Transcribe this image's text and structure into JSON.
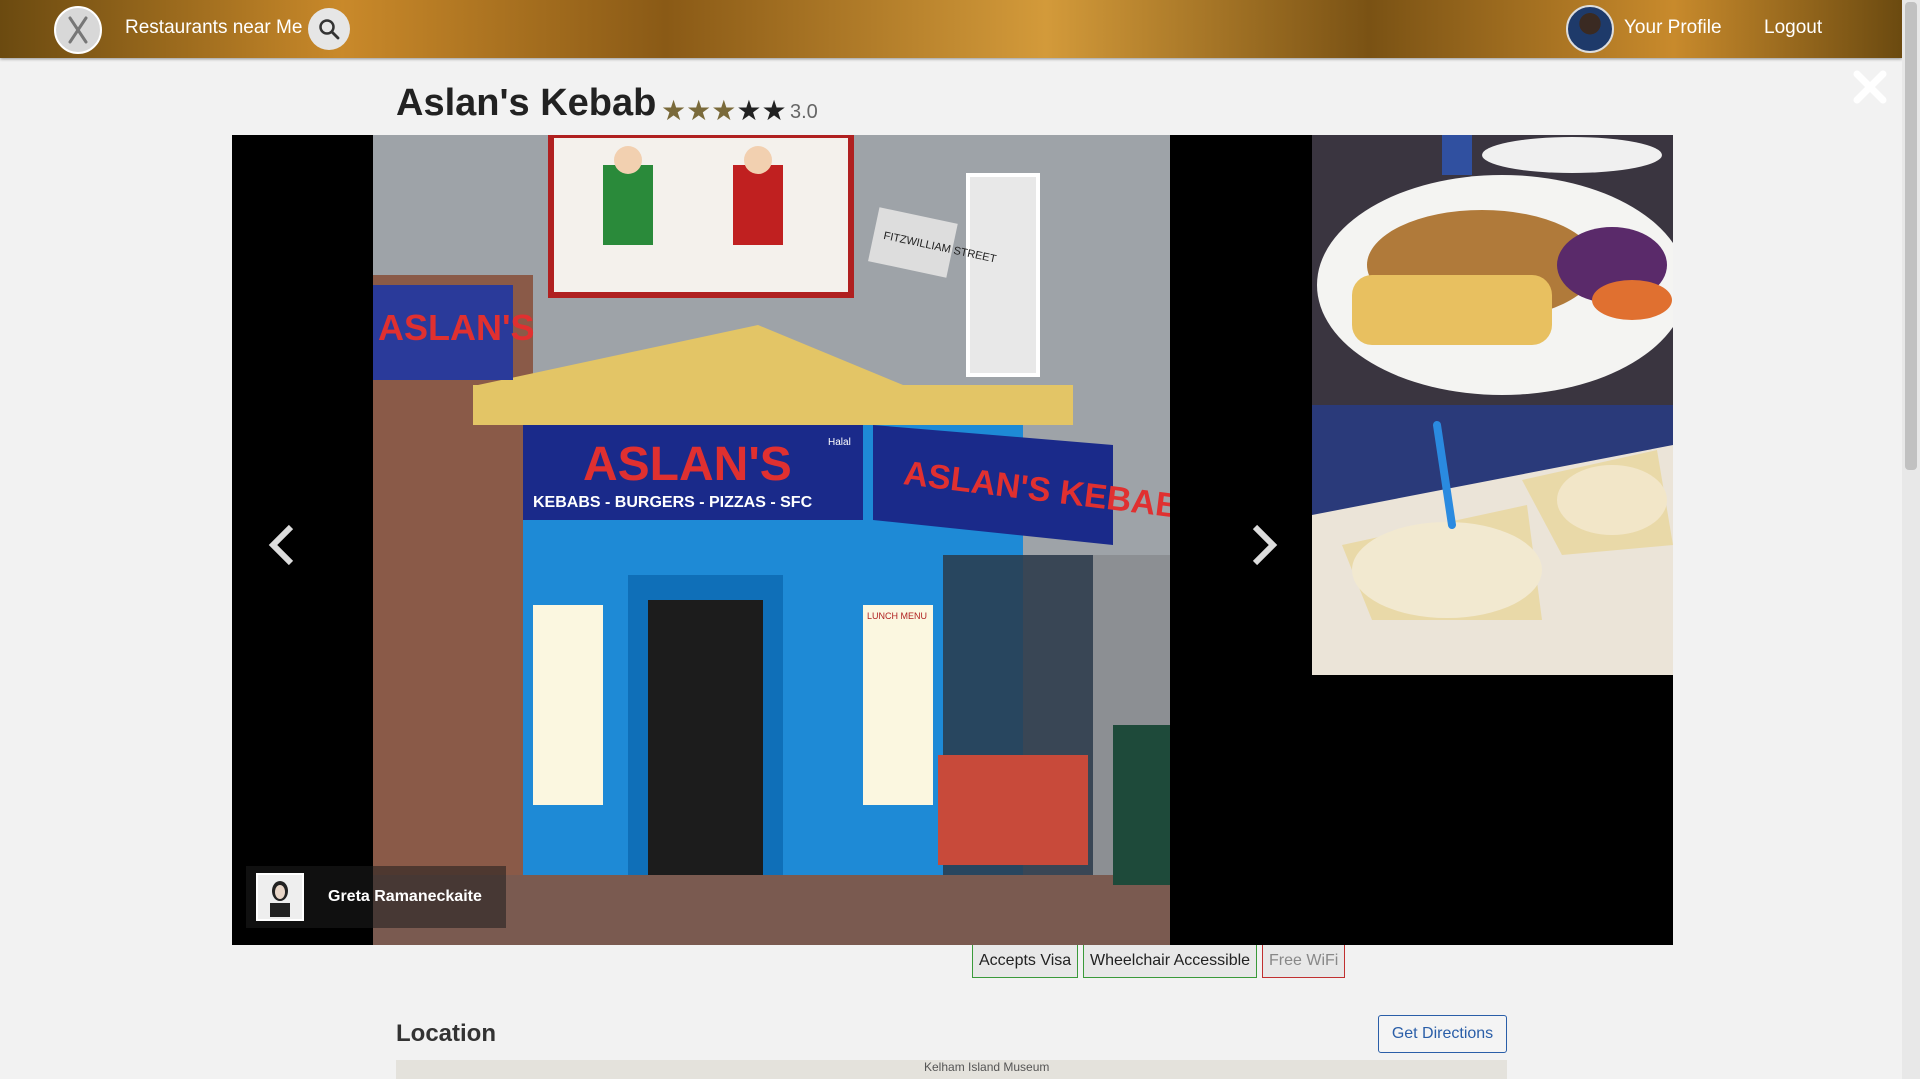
{
  "nav": {
    "brand": "Restaurants near Me",
    "profile": "Your Profile",
    "logout": "Logout"
  },
  "restaurant": {
    "name": "Aslan's Kebab",
    "rating": "3.0",
    "stars_filled": 3,
    "stars_total": 5
  },
  "photo_viewer": {
    "credit_name": "Greta Ramaneckaite",
    "sign_main": "ASLAN'S",
    "sign_sub": "KEBABS - BURGERS - PIZZAS - SFC",
    "sign_side": "ASLAN'S KEBABS",
    "sign_left": "ASLAN'S",
    "street_sign": "FITZWILLIAM STREET",
    "lunch_menu": "LUNCH MENU",
    "halal": "Halal"
  },
  "features": [
    {
      "label": "Accepts Visa",
      "available": true
    },
    {
      "label": "Wheelchair Accessible",
      "available": true
    },
    {
      "label": "Free WiFi",
      "available": false
    }
  ],
  "location": {
    "title": "Location",
    "directions_label": "Get Directions",
    "map_label": "Kelham Island Museum"
  },
  "colors": {
    "feature_on": "#3a9a3a",
    "feature_off": "#c03030",
    "link": "#2a5ea8",
    "shop_blue": "#1e8ad6"
  }
}
